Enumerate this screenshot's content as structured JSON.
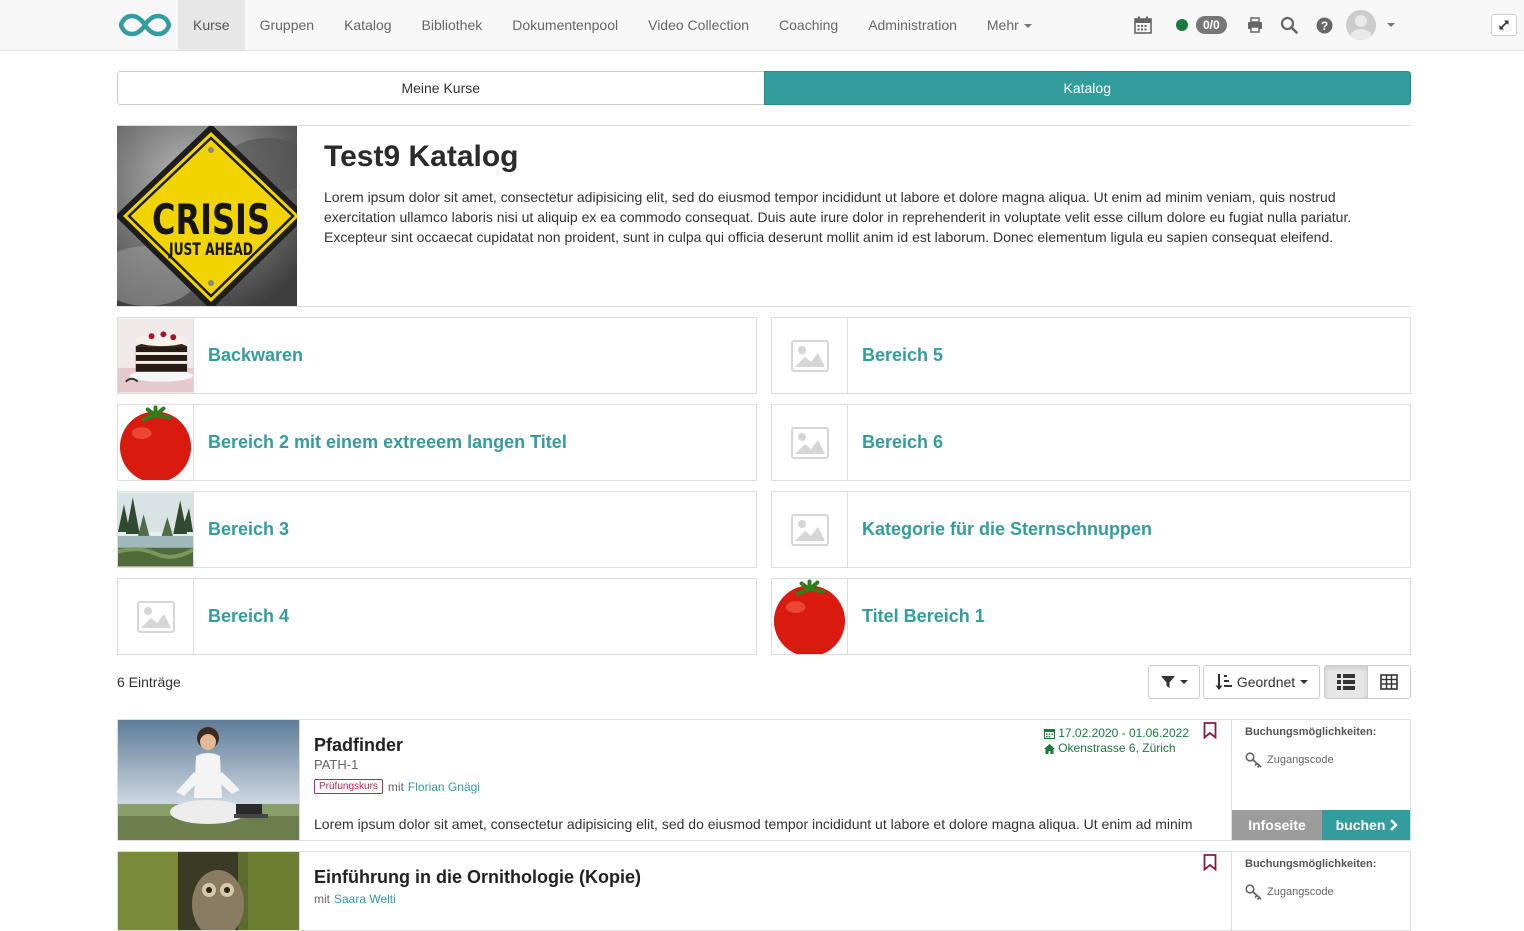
{
  "nav": {
    "items": [
      {
        "label": "Kurse",
        "active": true
      },
      {
        "label": "Gruppen"
      },
      {
        "label": "Katalog"
      },
      {
        "label": "Bibliothek"
      },
      {
        "label": "Dokumentenpool"
      },
      {
        "label": "Video Collection"
      },
      {
        "label": "Coaching"
      },
      {
        "label": "Administration"
      },
      {
        "label": "Mehr"
      }
    ],
    "badge": "0/0",
    "icons": [
      "calendar-icon",
      "status-dot",
      "print-icon",
      "search-icon",
      "help-icon",
      "avatar",
      "expand-icon"
    ]
  },
  "toggle": {
    "left": "Meine Kurse",
    "right": "Katalog"
  },
  "header": {
    "title": "Test9 Katalog",
    "image_text_line1": "CRISIS",
    "image_text_line2": "JUST AHEAD",
    "description": "Lorem ipsum dolor sit amet, consectetur adipisicing elit, sed do eiusmod tempor incididunt ut labore et dolore magna aliqua. Ut enim ad minim veniam, quis nostrud exercitation ullamco laboris nisi ut aliquip ex ea commodo consequat. Duis aute irure dolor in reprehenderit in voluptate velit esse cillum dolore eu fugiat nulla pariatur. Excepteur sint occaecat cupidatat non proident, sunt in culpa qui officia deserunt mollit anim id est laborum. Donec elementum ligula eu sapien consequat eleifend."
  },
  "categories": [
    {
      "label": "Backwaren",
      "thumb": "cake"
    },
    {
      "label": "Bereich 5",
      "thumb": "placeholder"
    },
    {
      "label": "Bereich 2 mit einem extreeem langen Titel",
      "thumb": "tomato"
    },
    {
      "label": "Bereich 6",
      "thumb": "placeholder"
    },
    {
      "label": "Bereich 3",
      "thumb": "forest"
    },
    {
      "label": "Kategorie für die Sternschnuppen",
      "thumb": "placeholder"
    },
    {
      "label": "Bereich 4",
      "thumb": "placeholder"
    },
    {
      "label": "Titel Bereich 1",
      "thumb": "tomato"
    }
  ],
  "toolbar": {
    "count": "6 Einträge",
    "sort_label": "Geordnet",
    "view_mode": "list"
  },
  "courses": [
    {
      "title": "Pfadfinder",
      "external_ref": "PATH-1",
      "badge": "Prüfungskurs",
      "with_prefix": "mit",
      "author": "Florian Gnägi",
      "dates": "17.02.2020 - 01.06.2022",
      "location": "Okenstrasse 6, Zürich",
      "description": "Lorem ipsum dolor sit amet, consectetur adipisicing elit, sed do eiusmod tempor incididunt ut labore et dolore magna aliqua. Ut enim ad minim veniam, quis nostrud exercitation ullamco laboris nisi ut aliquip ex ea commodo consequat. Duis aute irure dolor",
      "booking_title": "Buchungsmöglichkeiten:",
      "booking_method": "Zugangscode",
      "info_label": "Infoseite",
      "book_label": "buchen"
    },
    {
      "title": "Einführung in die Ornithologie (Kopie)",
      "with_prefix": "mit",
      "author": "Saara Welti",
      "booking_title": "Buchungsmöglichkeiten:",
      "booking_method": "Zugangscode"
    }
  ],
  "colors": {
    "accent": "#339d9d",
    "dates_green": "#1a7a3e",
    "exam_red": "#c7254e",
    "bookmark": "#8b1a3a"
  }
}
